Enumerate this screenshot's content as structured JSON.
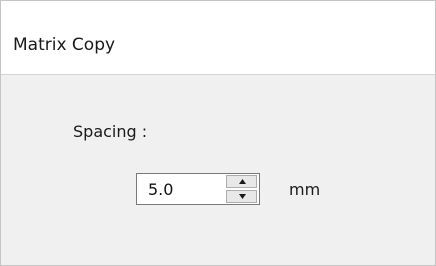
{
  "dialog": {
    "title": "Matrix Copy"
  },
  "spacing": {
    "label": "Spacing :",
    "value": "5.0",
    "unit": "mm",
    "up_icon": "triangle-up-icon",
    "down_icon": "triangle-down-icon"
  }
}
